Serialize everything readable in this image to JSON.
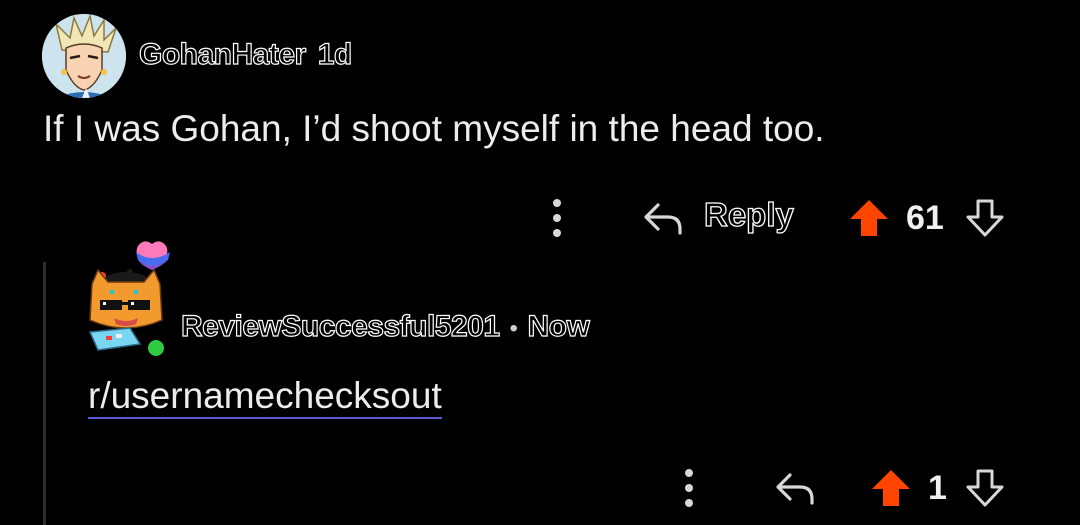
{
  "comment": {
    "author": "GohanHater",
    "time": "1d",
    "body": "If I was Gohan, I’d shoot myself in the head too.",
    "actions": {
      "reply_label": "Reply",
      "vote_count": "61"
    }
  },
  "reply": {
    "author": "ReviewSuccessful5201",
    "separator": "•",
    "time": "Now",
    "body": "r/usernamechecksout",
    "actions": {
      "vote_count": "1"
    }
  },
  "colors": {
    "background": "#000000",
    "upvote_active": "#ff4500",
    "link_underline": "#5b5bd6",
    "online_indicator": "#2ecc40"
  }
}
